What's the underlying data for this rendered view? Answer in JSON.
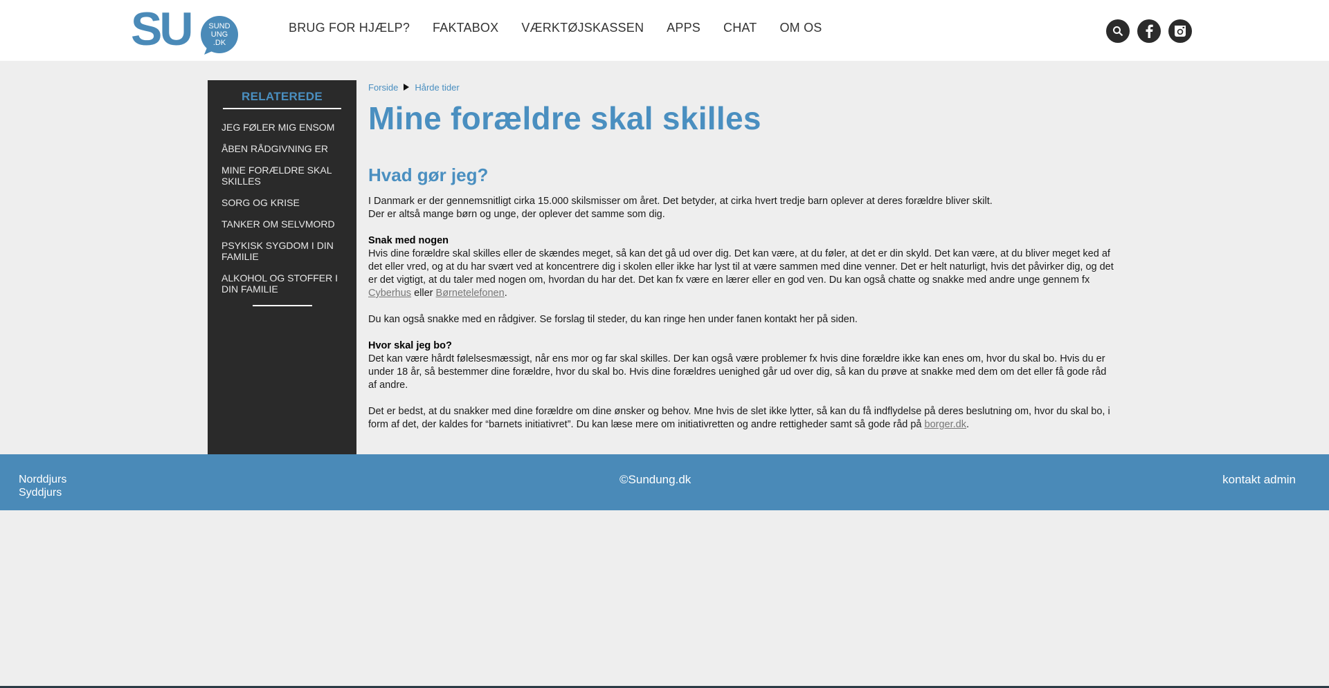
{
  "brand": {
    "logo_letters": "SU",
    "logo_sub": [
      "SUND",
      "UNG",
      ".DK"
    ],
    "brand_color": "#4a8ab8"
  },
  "nav": {
    "items": [
      "BRUG FOR HJÆLP?",
      "FAKTABOX",
      "VÆRKTØJSKASSEN",
      "APPS",
      "CHAT",
      "OM OS"
    ]
  },
  "social": {
    "icons": [
      "search-icon",
      "facebook-icon",
      "instagram-icon"
    ]
  },
  "sidebar": {
    "title": "RELATEREDE",
    "items": [
      {
        "label": "JEG FØLER MIG ENSOM"
      },
      {
        "label": "ÅBEN RÅDGIVNING ER"
      },
      {
        "label": "MINE FORÆLDRE SKAL SKILLES"
      },
      {
        "label": "SORG OG KRISE"
      },
      {
        "label": "TANKER OM SELVMORD"
      },
      {
        "label": "PSYKISK SYGDOM I DIN FAMILIE"
      },
      {
        "label": "ALKOHOL OG STOFFER I DIN FAMILIE"
      }
    ]
  },
  "breadcrumb": {
    "home": "Forside",
    "current": "Hårde tider"
  },
  "page": {
    "title": "Mine forældre skal skilles",
    "subtitle": "Hvad gør jeg?",
    "intro_1": "I Danmark er der gennemsnitligt cirka 15.000 skilsmisser om året. Det betyder, at cirka hvert tredje barn oplever at deres forældre bliver skilt.",
    "intro_2": "Der er altså mange børn og unge, der oplever det samme som dig.",
    "section1_heading": "Snak med nogen",
    "section1_text": "Hvis dine forældre skal skilles eller de skændes meget, så kan det gå ud over dig. Det kan være, at du føler, at det er din skyld. Det kan være, at du bliver meget ked af det eller vred, og at du har svært ved at koncentrere dig i skolen eller ikke har lyst til at være sammen med dine venner. Det er helt naturligt, hvis det påvirker dig, og det er det vigtigt, at du taler med nogen om, hvordan du har det. Det kan fx være en lærer eller en god ven. Du kan også chatte og snakke med andre unge gennem fx ",
    "link_cyberhus": "Cyberhus",
    "between_links": " eller ",
    "link_bornetelefonen": "Børnetelefonen",
    "section1_end": ".",
    "para_advisor": "Du kan også snakke med en rådgiver. Se forslag til steder, du kan ringe hen under fanen kontakt her på siden.",
    "section2_heading": "Hvor skal jeg bo?",
    "section2_text": "Det kan være hårdt følelsesmæssigt, når ens mor og far skal skilles. Der kan også være problemer fx hvis dine forældre ikke kan enes om, hvor du skal bo. Hvis du er under 18 år, så bestemmer dine forældre, hvor du skal bo. Hvis dine forældres uenighed går ud over dig, så kan du prøve at snakke med dem om det eller få gode råd af andre.",
    "para_last": "Det er bedst, at du snakker med dine forældre om dine ønsker og behov. Mne hvis de slet ikke lytter, så kan du få indflydelse på deres beslutning om, hvor du skal bo, i form af det, der kaldes for “barnets initiativret”. Du kan læse mere om initiativretten og andre rettigheder samt så gode råd på ",
    "link_borger": "borger.dk",
    "para_last_end": "."
  },
  "footer": {
    "region_1": "Norddjurs",
    "region_2": "Syddjurs",
    "copyright": "©Sundung.dk",
    "contact": "kontakt admin"
  }
}
